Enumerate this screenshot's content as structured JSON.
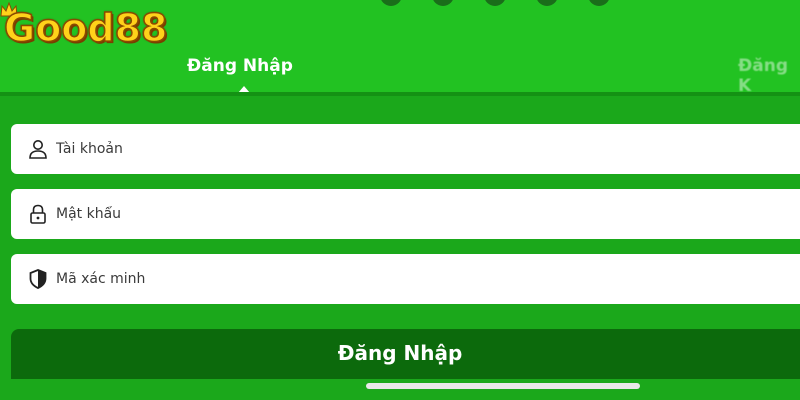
{
  "brand": {
    "logo_text": "Good88"
  },
  "tabs": {
    "login": "Đăng Nhập",
    "register": "Đăng K"
  },
  "form": {
    "username_placeholder": "Tài khoản",
    "password_placeholder": "Mật khẩu",
    "captcha_placeholder": "Mã xác minh",
    "submit_label": "Đăng Nhập"
  },
  "icons": {
    "username": "user-icon",
    "password": "lock-icon",
    "captcha": "shield-icon"
  },
  "colors": {
    "header_green": "#22c222",
    "body_green": "#1ba81b",
    "button_green": "#0c6a0c",
    "logo_gold": "#ffd21a"
  }
}
